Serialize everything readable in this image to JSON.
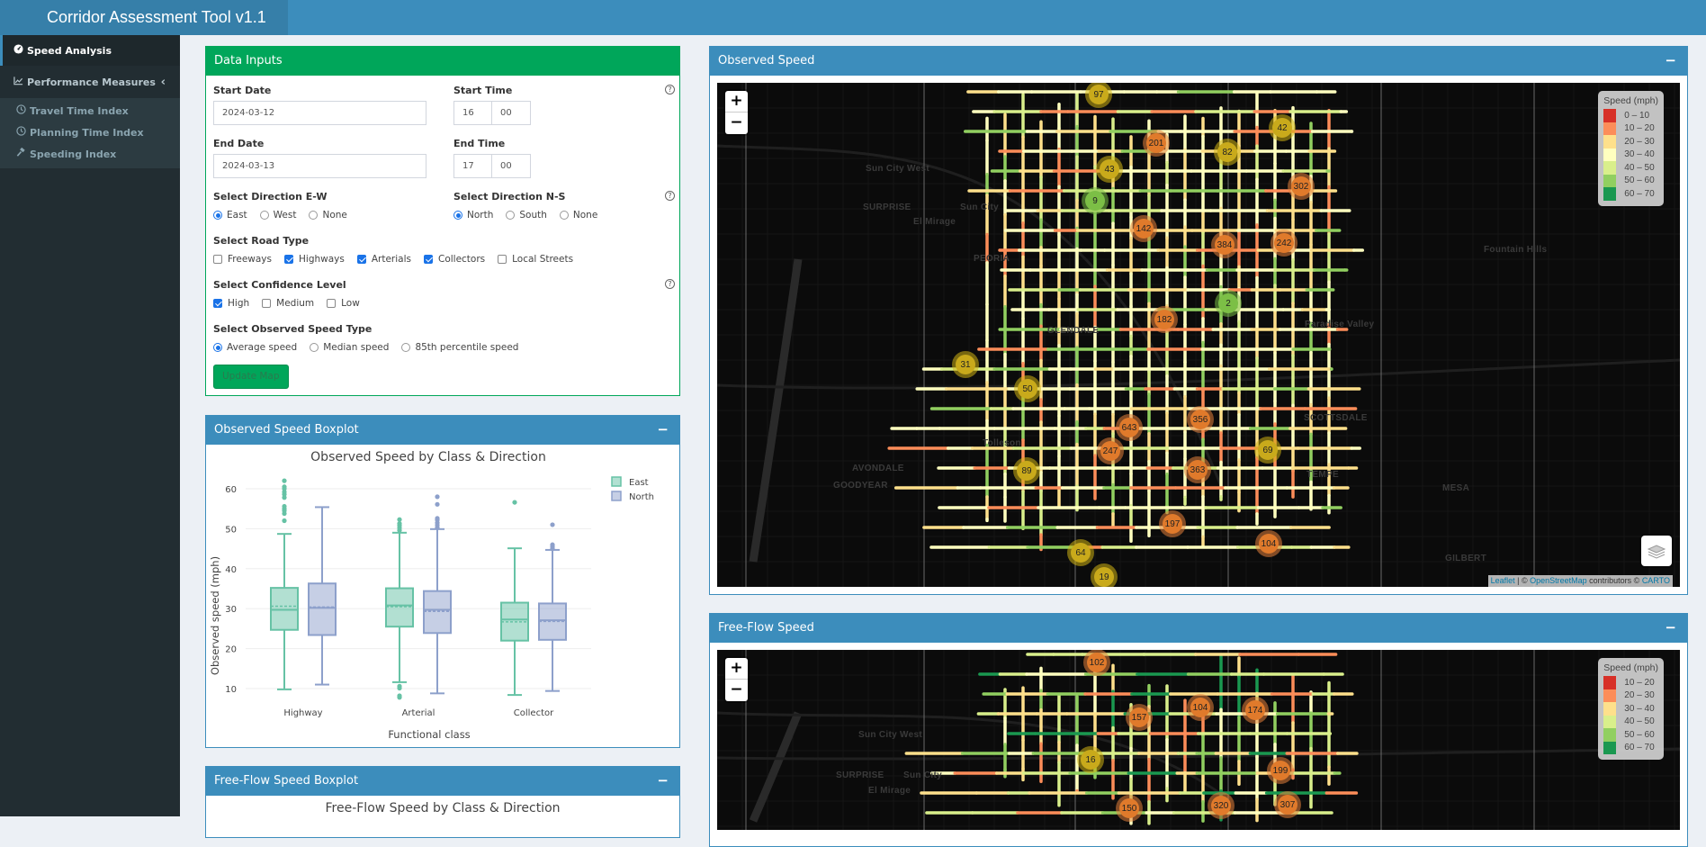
{
  "app": {
    "title": "Corridor Assessment Tool v1.1"
  },
  "sidebar": {
    "items": [
      {
        "label": "Speed Analysis",
        "icon": "tachometer-icon",
        "active": true
      },
      {
        "label": "Performance Measures",
        "icon": "line-chart-icon",
        "expanded": true
      }
    ],
    "subitems": [
      {
        "label": "Travel Time Index",
        "icon": "clock-icon"
      },
      {
        "label": "Planning Time Index",
        "icon": "clock-icon"
      },
      {
        "label": "Speeding Index",
        "icon": "gavel-icon"
      }
    ]
  },
  "data_inputs": {
    "title": "Data Inputs",
    "start_date_label": "Start Date",
    "start_date": "2024-03-12",
    "end_date_label": "End Date",
    "end_date": "2024-03-13",
    "start_time_label": "Start Time",
    "start_hour": "16",
    "start_minute": "00",
    "end_time_label": "End Time",
    "end_hour": "17",
    "end_minute": "00",
    "dir_ew_label": "Select Direction E-W",
    "dir_ew_options": [
      {
        "label": "East",
        "checked": true
      },
      {
        "label": "West",
        "checked": false
      },
      {
        "label": "None",
        "checked": false
      }
    ],
    "dir_ns_label": "Select Direction N-S",
    "dir_ns_options": [
      {
        "label": "North",
        "checked": true
      },
      {
        "label": "South",
        "checked": false
      },
      {
        "label": "None",
        "checked": false
      }
    ],
    "road_type_label": "Select Road Type",
    "road_types": [
      {
        "label": "Freeways",
        "checked": false
      },
      {
        "label": "Highways",
        "checked": true
      },
      {
        "label": "Arterials",
        "checked": true
      },
      {
        "label": "Collectors",
        "checked": true
      },
      {
        "label": "Local Streets",
        "checked": false
      }
    ],
    "confidence_label": "Select Confidence Level",
    "confidence_levels": [
      {
        "label": "High",
        "checked": true
      },
      {
        "label": "Medium",
        "checked": false
      },
      {
        "label": "Low",
        "checked": false
      }
    ],
    "speed_type_label": "Select Observed Speed Type",
    "speed_types": [
      {
        "label": "Average speed",
        "checked": true
      },
      {
        "label": "Median speed",
        "checked": false
      },
      {
        "label": "85th percentile speed",
        "checked": false
      }
    ],
    "update_button": "Update Map",
    "help_glyph": "?"
  },
  "observed_boxplot": {
    "box_title": "Observed Speed Boxplot",
    "collapse_glyph": "−"
  },
  "freeflow_boxplot": {
    "box_title": "Free-Flow Speed Boxplot",
    "chart_title": "Free-Flow Speed by Class & Direction",
    "collapse_glyph": "−"
  },
  "chart_data": {
    "type": "box",
    "title": "Observed Speed by Class & Direction",
    "xlabel": "Functional class",
    "ylabel": "Observed speed (mph)",
    "categories": [
      "Highway",
      "Arterial",
      "Collector"
    ],
    "yticks": [
      10,
      20,
      30,
      40,
      50,
      60
    ],
    "ylim": [
      5,
      63
    ],
    "grid": true,
    "legend_position": "top-right",
    "series": [
      {
        "name": "East",
        "color": "#66c2a5",
        "boxes": [
          {
            "q1": 24.7,
            "median": 29.7,
            "mean": 30.6,
            "q3": 35.2,
            "lower": 9.8,
            "upper": 48.7,
            "outliers": [
              52,
              53.8,
              54.5,
              55,
              55.6,
              57.8,
              58.6,
              59.2,
              60,
              60.5,
              62
            ]
          },
          {
            "q1": 25.5,
            "median": 30.8,
            "mean": 30.5,
            "q3": 35.1,
            "lower": 11.6,
            "upper": 49.0,
            "outliers": [
              49.6,
              50.2,
              50.8,
              51.3,
              52.3,
              7.8,
              8.2,
              10.1,
              10.6
            ]
          },
          {
            "q1": 22.0,
            "median": 27.3,
            "mean": 26.7,
            "q3": 31.5,
            "lower": 8.4,
            "upper": 45.1,
            "outliers": [
              56.6
            ]
          }
        ]
      },
      {
        "name": "North",
        "color": "#8da0cb",
        "boxes": [
          {
            "q1": 23.4,
            "median": 30.2,
            "mean": 30.4,
            "q3": 36.3,
            "lower": 11.0,
            "upper": 55.4,
            "outliers": []
          },
          {
            "q1": 23.9,
            "median": 29.7,
            "mean": 29.3,
            "q3": 34.4,
            "lower": 8.8,
            "upper": 49.9,
            "outliers": [
              50.3,
              50.9,
              51.5,
              52.2,
              52.6,
              56.1,
              58
            ]
          },
          {
            "q1": 22.2,
            "median": 27.1,
            "mean": 26.8,
            "q3": 31.3,
            "lower": 9.4,
            "upper": 44.7,
            "outliers": [
              45.0,
              45.5,
              46.0,
              51.0
            ]
          }
        ]
      }
    ]
  },
  "observed_map": {
    "title": "Observed Speed",
    "collapse_glyph": "−",
    "zoom_in": "+",
    "zoom_out": "−",
    "legend_title": "Speed (mph)",
    "legend": [
      {
        "label": "0 – 10",
        "color": "#d73027"
      },
      {
        "label": "10 – 20",
        "color": "#fc8d59"
      },
      {
        "label": "20 – 30",
        "color": "#fee08b"
      },
      {
        "label": "30 – 40",
        "color": "#ffffbf"
      },
      {
        "label": "40 – 50",
        "color": "#d9ef8b"
      },
      {
        "label": "50 – 60",
        "color": "#91cf60"
      },
      {
        "label": "60 – 70",
        "color": "#1a9850"
      }
    ],
    "place_labels": [
      "Sun City West",
      "SURPRISE",
      "Sun City",
      "El Mirage",
      "PEORIA",
      "GLENDALE",
      "Paradise Valley",
      "SCOTTSDALE",
      "Fountain Hills",
      "Tolleson",
      "AVONDALE",
      "GOODYEAR",
      "TEMPE",
      "MESA",
      "GILBERT"
    ],
    "clusters": [
      {
        "count": "97",
        "tone": "yellow"
      },
      {
        "count": "201",
        "tone": "orange"
      },
      {
        "count": "82",
        "tone": "yellow"
      },
      {
        "count": "42",
        "tone": "yellow"
      },
      {
        "count": "43",
        "tone": "yellow"
      },
      {
        "count": "302",
        "tone": "orange"
      },
      {
        "count": "9",
        "tone": "green"
      },
      {
        "count": "142",
        "tone": "orange"
      },
      {
        "count": "384",
        "tone": "orange"
      },
      {
        "count": "242",
        "tone": "orange"
      },
      {
        "count": "2",
        "tone": "green"
      },
      {
        "count": "182",
        "tone": "orange"
      },
      {
        "count": "31",
        "tone": "yellow"
      },
      {
        "count": "50",
        "tone": "yellow"
      },
      {
        "count": "643",
        "tone": "orange"
      },
      {
        "count": "356",
        "tone": "orange"
      },
      {
        "count": "247",
        "tone": "orange"
      },
      {
        "count": "363",
        "tone": "orange"
      },
      {
        "count": "69",
        "tone": "yellow"
      },
      {
        "count": "89",
        "tone": "yellow"
      },
      {
        "count": "197",
        "tone": "orange"
      },
      {
        "count": "104",
        "tone": "orange"
      },
      {
        "count": "64",
        "tone": "yellow"
      },
      {
        "count": "19",
        "tone": "yellow"
      }
    ],
    "attribution": {
      "leaflet": "Leaflet",
      "sep": " | © ",
      "osm": "OpenStreetMap",
      "contrib": " contributors © ",
      "carto": "CARTO"
    }
  },
  "freeflow_map": {
    "title": "Free-Flow Speed",
    "collapse_glyph": "−",
    "zoom_in": "+",
    "zoom_out": "−",
    "legend_title": "Speed (mph)",
    "legend": [
      {
        "label": "10 – 20",
        "color": "#d73027"
      },
      {
        "label": "20 – 30",
        "color": "#fc8d59"
      },
      {
        "label": "30 – 40",
        "color": "#fee08b"
      },
      {
        "label": "40 – 50",
        "color": "#d9ef8b"
      },
      {
        "label": "50 – 60",
        "color": "#91cf60"
      },
      {
        "label": "60 – 70",
        "color": "#1a9850"
      }
    ],
    "place_labels": [
      "Sun City West",
      "SURPRISE",
      "Sun City",
      "El Mirage"
    ],
    "clusters": [
      {
        "count": "102",
        "tone": "orange"
      },
      {
        "count": "157",
        "tone": "orange"
      },
      {
        "count": "104",
        "tone": "orange"
      },
      {
        "count": "174",
        "tone": "orange"
      },
      {
        "count": "16",
        "tone": "yellow"
      },
      {
        "count": "199",
        "tone": "orange"
      },
      {
        "count": "150",
        "tone": "orange"
      },
      {
        "count": "320",
        "tone": "orange"
      },
      {
        "count": "307",
        "tone": "orange"
      }
    ]
  }
}
